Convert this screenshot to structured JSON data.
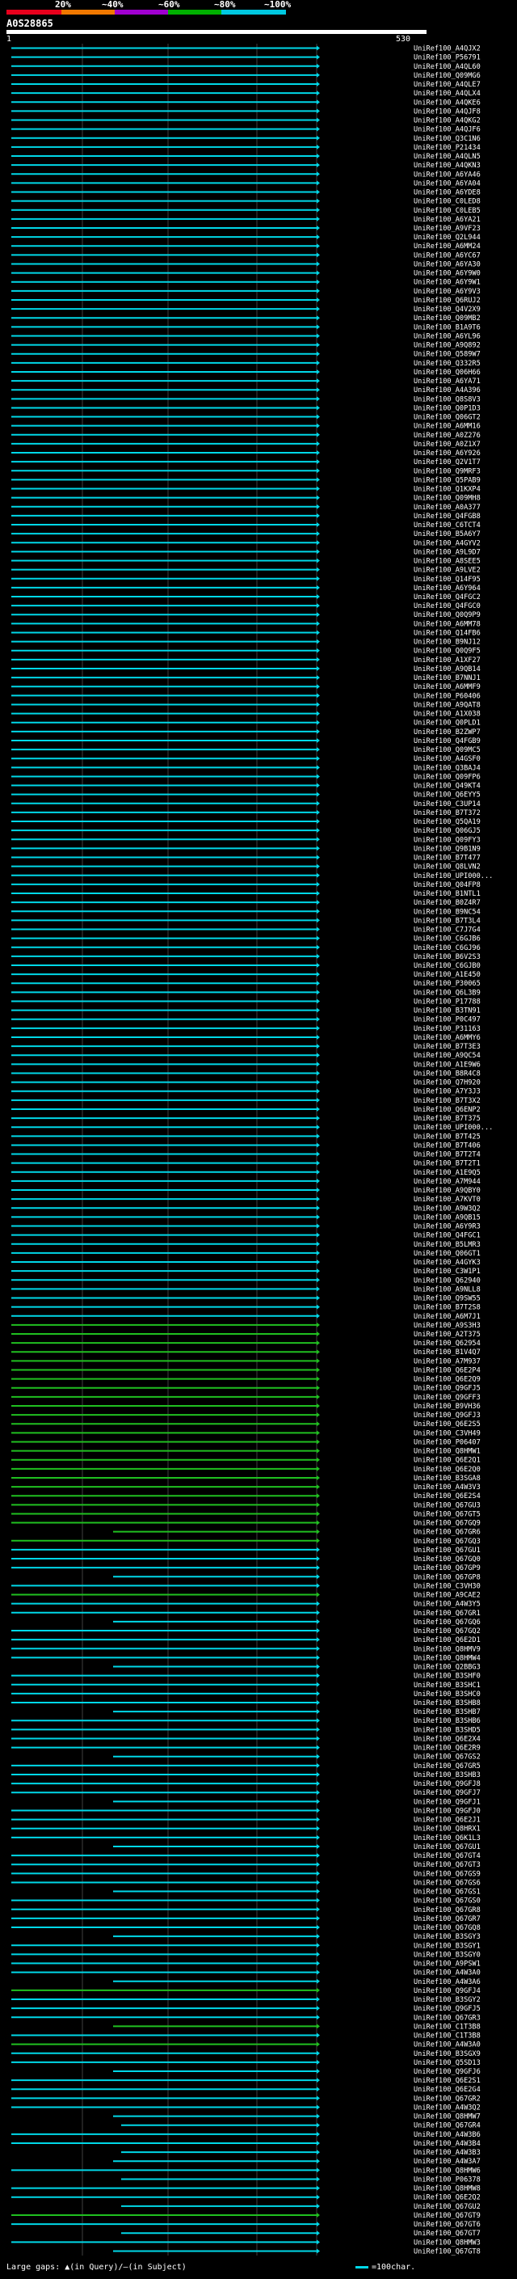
{
  "percent_scale": {
    "labels": [
      "20%",
      "~40%",
      "~60%",
      "~80%",
      "~100%"
    ],
    "colors": [
      "#e8001c",
      "#f07800",
      "#a000d0",
      "#00b000",
      "#00c8e0"
    ]
  },
  "query": {
    "id": "A0S28865",
    "start_label": "1",
    "end_label": "530"
  },
  "legend": {
    "large_gaps": "Large gaps: ▲(in Query)/–(in Subject)",
    "scale": "=100char."
  },
  "colors": {
    "cyan": "#00d8e8",
    "green": "#20c020",
    "grid": "#404040"
  },
  "hit_ids": [
    "UniRef100_A4QJX2",
    "UniRef100_P56791",
    "UniRef100_A4QL60",
    "UniRef100_Q09MG6",
    "UniRef100_A4QLE7",
    "UniRef100_A4QLX4",
    "UniRef100_A4QKE6",
    "UniRef100_A4QJF8",
    "UniRef100_A4QKG2",
    "UniRef100_A4QJF6",
    "UniRef100_Q3C1N6",
    "UniRef100_P21434",
    "UniRef100_A4QLN5",
    "UniRef100_A4QKN3",
    "UniRef100_A6YA46",
    "UniRef100_A6YA04",
    "UniRef100_A6YDE8",
    "UniRef100_C0LED8",
    "UniRef100_C0LEB5",
    "UniRef100_A6YA21",
    "UniRef100_A9VF23",
    "UniRef100_Q2L944",
    "UniRef100_A6MM24",
    "UniRef100_A6YC67",
    "UniRef100_A6YA30",
    "UniRef100_A6Y9W0",
    "UniRef100_A6Y9W1",
    "UniRef100_A6Y9V3",
    "UniRef100_Q6RUJ2",
    "UniRef100_Q4V2X9",
    "UniRef100_Q09MB2",
    "UniRef100_B1A9T6",
    "UniRef100_A6YL96",
    "UniRef100_A9Q892",
    "UniRef100_Q589W7",
    "UniRef100_Q332R5",
    "UniRef100_Q06H66",
    "UniRef100_A6YA71",
    "UniRef100_A4A396",
    "UniRef100_Q8S8V3",
    "UniRef100_Q0P1D3",
    "UniRef100_Q06GT2",
    "UniRef100_A6MM16",
    "UniRef100_A0Z276",
    "UniRef100_A0Z1X7",
    "UniRef100_A6Y926",
    "UniRef100_Q2V1T7",
    "UniRef100_Q9MRF3",
    "UniRef100_Q5PAB9",
    "UniRef100_Q1KXP4",
    "UniRef100_Q09MH8",
    "UniRef100_A0A377",
    "UniRef100_Q4FGB8",
    "UniRef100_C6TCT4",
    "UniRef100_B5A6Y7",
    "UniRef100_A4GYV2",
    "UniRef100_A9L9D7",
    "UniRef100_A8SEE5",
    "UniRef100_A9LVE2",
    "UniRef100_Q14F95",
    "UniRef100_A6Y964",
    "UniRef100_Q4FGC2",
    "UniRef100_Q4FGC0",
    "UniRef100_Q0Q9P9",
    "UniRef100_A6MM78",
    "UniRef100_Q14FB6",
    "UniRef100_B9NJ12",
    "UniRef100_Q0Q9F5",
    "UniRef100_A1XF27",
    "UniRef100_A9QB14",
    "UniRef100_B7NNJ1",
    "UniRef100_A6MMF9",
    "UniRef100_P60406",
    "UniRef100_A9QAT8",
    "UniRef100_A1X038",
    "UniRef100_Q0PLD1",
    "UniRef100_B2ZWP7",
    "UniRef100_Q4FGB9",
    "UniRef100_Q09MC5",
    "UniRef100_A4GSF0",
    "UniRef100_Q3BAJ4",
    "UniRef100_Q09FP6",
    "UniRef100_Q49KT4",
    "UniRef100_Q6EYY5",
    "UniRef100_C3UP14",
    "UniRef100_B7T372",
    "UniRef100_Q5QA19",
    "UniRef100_Q06GJ5",
    "UniRef100_Q09FY3",
    "UniRef100_Q9B1N9",
    "UniRef100_B7T477",
    "UniRef100_Q8LVN2",
    "UniRef100_UPI000...",
    "UniRef100_Q04FP8",
    "UniRef100_B1NTL1",
    "UniRef100_B0Z4R7",
    "UniRef100_B9NC54",
    "UniRef100_B7T3L4",
    "UniRef100_C7J7G4",
    "UniRef100_C6GJB6",
    "UniRef100_C6GJ96",
    "UniRef100_B6V2S3",
    "UniRef100_C6GJB0",
    "UniRef100_A1E450",
    "UniRef100_P30065",
    "UniRef100_Q6L3B9",
    "UniRef100_P17788",
    "UniRef100_B3TN91",
    "UniRef100_P0C497",
    "UniRef100_P31163",
    "UniRef100_A6MMY6",
    "UniRef100_B7T3E3",
    "UniRef100_A9QC54",
    "UniRef100_A1E9W6",
    "UniRef100_B8R4C8",
    "UniRef100_Q7H920",
    "UniRef100_A7Y3J3",
    "UniRef100_B7T3X2",
    "UniRef100_Q6ENP2",
    "UniRef100_B7T375",
    "UniRef100_UPI000...",
    "UniRef100_B7T425",
    "UniRef100_B7T406",
    "UniRef100_B7T2T4",
    "UniRef100_B7T2T1",
    "UniRef100_A1E9Q5",
    "UniRef100_A7M944",
    "UniRef100_A9QBY0",
    "UniRef100_A7KVT0",
    "UniRef100_A9W3Q2",
    "UniRef100_A9QB15",
    "UniRef100_A6Y9R3",
    "UniRef100_Q4FGC1",
    "UniRef100_B5LMR3",
    "UniRef100_Q06GT1",
    "UniRef100_A4GYK3",
    "UniRef100_C3W1P1",
    "UniRef100_Q62940",
    "UniRef100_A9NLL8",
    "UniRef100_Q9SW55",
    "UniRef100_B7T2S8",
    "UniRef100_A6M7J1",
    "UniRef100_A9S3H3",
    "UniRef100_A2T375",
    "UniRef100_Q62954",
    "UniRef100_B1V4Q7",
    "UniRef100_A7M937",
    "UniRef100_Q6E2P4",
    "UniRef100_Q6E2Q9",
    "UniRef100_Q9GFJ5",
    "UniRef100_Q9GFF3",
    "UniRef100_B9VH36",
    "UniRef100_Q9GFJ3",
    "UniRef100_Q6E2S5",
    "UniRef100_C3VH49",
    "UniRef100_P06407",
    "UniRef100_Q8HMW1",
    "UniRef100_Q6E2Q1",
    "UniRef100_Q6E2Q0",
    "UniRef100_B3SGA8",
    "UniRef100_A4W3V3",
    "UniRef100_Q6E2S4",
    "UniRef100_Q67GU3",
    "UniRef100_Q67GT5",
    "UniRef100_Q67GQ9",
    "UniRef100_Q67GR6",
    "UniRef100_Q67GQ3",
    "UniRef100_Q67GU1",
    "UniRef100_Q67GQ0",
    "UniRef100_Q67GP9",
    "UniRef100_Q67GP8",
    "UniRef100_C3VH30",
    "UniRef100_A9CAE2",
    "UniRef100_A4W3Y5",
    "UniRef100_Q67GR1",
    "UniRef100_Q67GQ6",
    "UniRef100_Q67GQ2",
    "UniRef100_Q6E2D1",
    "UniRef100_Q8HMV9",
    "UniRef100_Q8HMW4",
    "UniRef100_Q2BBG3",
    "UniRef100_B3SHF0",
    "UniRef100_B3SHC1",
    "UniRef100_B3SHC0",
    "UniRef100_B3SHB8",
    "UniRef100_B3SHB7",
    "UniRef100_B3SHB6",
    "UniRef100_B3SHD5",
    "UniRef100_Q6E2X4",
    "UniRef100_Q6E2R9",
    "UniRef100_Q67GS2",
    "UniRef100_Q67GR5",
    "UniRef100_B3SHB3",
    "UniRef100_Q9GFJ8",
    "UniRef100_Q9GFJ7",
    "UniRef100_Q9GFJ1",
    "UniRef100_Q9GFJ0",
    "UniRef100_Q6E2J1",
    "UniRef100_Q8HRX1",
    "UniRef100_Q6K1L3",
    "UniRef100_Q67GU1",
    "UniRef100_Q67GT4",
    "UniRef100_Q67GT3",
    "UniRef100_Q67GS9",
    "UniRef100_Q67GS6",
    "UniRef100_Q67GS1",
    "UniRef100_Q67GS0",
    "UniRef100_Q67GR8",
    "UniRef100_Q67GR7",
    "UniRef100_Q67GQ8",
    "UniRef100_B3SGY3",
    "UniRef100_B3SGY1",
    "UniRef100_B3SGY0",
    "UniRef100_A9PSW1",
    "UniRef100_A4W3A0",
    "UniRef100_A4W3A6",
    "UniRef100_Q9GFJ4",
    "UniRef100_B3SGY2",
    "UniRef100_Q9GFJ5",
    "UniRef100_Q67GR3",
    "UniRef100_C1T3B8",
    "UniRef100_C1T3B8",
    "UniRef100_A4W3A0",
    "UniRef100_B3SGX9",
    "UniRef100_Q5SD13",
    "UniRef100_Q9GFJ6",
    "UniRef100_Q6E2S1",
    "UniRef100_Q6E2G4",
    "UniRef100_Q67GR2",
    "UniRef100_A4W3Q2",
    "UniRef100_Q8HMW7",
    "UniRef100_Q67GR4",
    "UniRef100_A4W3B6",
    "UniRef100_A4W3B4",
    "UniRef100_A4W3B3",
    "UniRef100_A4W3A7",
    "UniRef100_Q8HMW6",
    "UniRef100_P06378",
    "UniRef100_Q8HMW8",
    "UniRef100_Q6E2Q2",
    "UniRef100_Q67GU2",
    "UniRef100_Q67GT9",
    "UniRef100_Q67GT6",
    "UniRef100_Q67GT7",
    "UniRef100_Q8HMW3",
    "UniRef100_Q67GT8"
  ],
  "green_rows": [
    142,
    143,
    144,
    145,
    146,
    147,
    148,
    149,
    150,
    151,
    152,
    153,
    154,
    155,
    156,
    157,
    158,
    159,
    160,
    161,
    162,
    163,
    164,
    165,
    166,
    172,
    216,
    220,
    222,
    241,
    262,
    270,
    275,
    281
  ]
}
